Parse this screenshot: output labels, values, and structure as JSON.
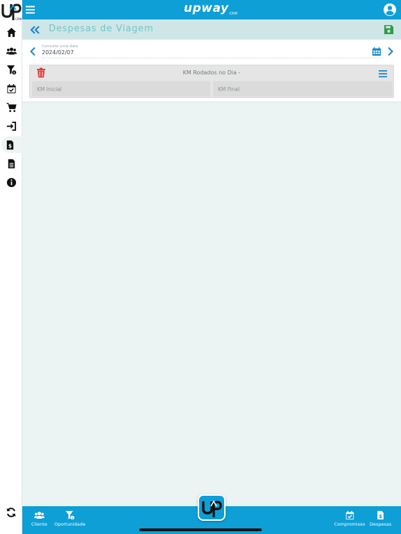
{
  "app": {
    "brand": "upway",
    "brand_sub": "CRM",
    "accent_color": "#0d9fd6",
    "side_logo_text": "UP",
    "side_logo_sub": "CRM"
  },
  "sidebar": {
    "items": [
      {
        "icon": "home-icon"
      },
      {
        "icon": "users-icon"
      },
      {
        "icon": "funnel-money-icon"
      },
      {
        "icon": "calendar-check-icon"
      },
      {
        "icon": "cart-icon"
      },
      {
        "icon": "sign-in-icon"
      },
      {
        "icon": "file-invoice-dollar-icon",
        "active": true
      },
      {
        "icon": "file-text-icon"
      },
      {
        "icon": "info-icon"
      }
    ],
    "footer_icon": "refresh-icon"
  },
  "header": {
    "page_title": "Despesas de Viagem"
  },
  "date_selector": {
    "hint": "Consulte uma data",
    "value": "2024/02/07"
  },
  "km_panel": {
    "title": "KM Rodados no Dia -",
    "start_placeholder": "KM Inicial",
    "end_placeholder": "KM Final"
  },
  "bottom_nav": {
    "left": [
      {
        "label": "Cliente",
        "icon": "users-icon"
      },
      {
        "label": "Oportunidade",
        "icon": "funnel-money-icon"
      }
    ],
    "center_logo": "UP",
    "right": [
      {
        "label": "Compromisso",
        "icon": "calendar-check-icon"
      },
      {
        "label": "Despesas",
        "icon": "file-invoice-dollar-icon"
      }
    ]
  }
}
